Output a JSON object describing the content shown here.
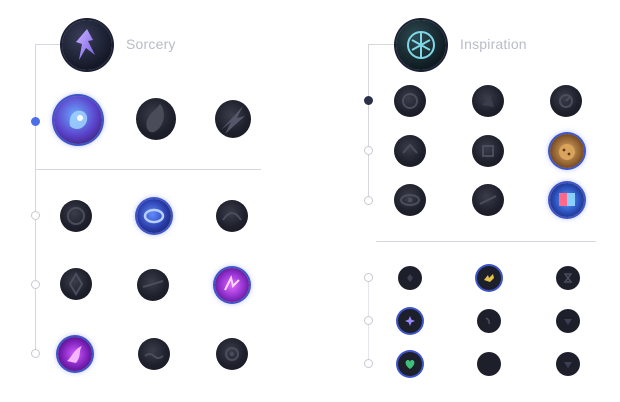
{
  "primary": {
    "title": "Sorcery",
    "icon": "sorcery-path-icon",
    "keystones": [
      {
        "icon": "summon-aery-icon",
        "selected": true
      },
      {
        "icon": "arcane-comet-icon",
        "selected": false
      },
      {
        "icon": "phase-rush-icon",
        "selected": false
      }
    ],
    "rows": [
      [
        {
          "icon": "nullifying-orb-icon",
          "selected": false
        },
        {
          "icon": "manaflow-band-icon",
          "selected": true
        },
        {
          "icon": "nimbus-cloak-icon",
          "selected": false
        }
      ],
      [
        {
          "icon": "transcendence-icon",
          "selected": false
        },
        {
          "icon": "celerity-icon",
          "selected": false
        },
        {
          "icon": "absolute-focus-icon",
          "selected": true
        }
      ],
      [
        {
          "icon": "scorch-icon",
          "selected": true
        },
        {
          "icon": "waterwalking-icon",
          "selected": false
        },
        {
          "icon": "gathering-storm-icon",
          "selected": false
        }
      ]
    ]
  },
  "secondary": {
    "title": "Inspiration",
    "icon": "inspiration-path-icon",
    "rows": [
      [
        {
          "icon": "hextech-flashtraption-icon",
          "selected": false
        },
        {
          "icon": "magical-footwear-icon",
          "selected": false
        },
        {
          "icon": "perfect-timing-icon",
          "selected": false
        }
      ],
      [
        {
          "icon": "future-market-icon",
          "selected": false
        },
        {
          "icon": "minion-dematerializer-icon",
          "selected": false
        },
        {
          "icon": "biscuit-delivery-icon",
          "selected": true
        }
      ],
      [
        {
          "icon": "cosmic-insight-icon",
          "selected": false
        },
        {
          "icon": "approach-velocity-icon",
          "selected": false
        },
        {
          "icon": "time-warp-tonic-icon",
          "selected": true
        }
      ]
    ],
    "shards": [
      [
        {
          "icon": "adaptive-force-shard-icon",
          "selected": false
        },
        {
          "icon": "attack-speed-shard-icon",
          "selected": true
        },
        {
          "icon": "ability-haste-shard-icon",
          "selected": false
        }
      ],
      [
        {
          "icon": "adaptive-force-shard-icon",
          "selected": true
        },
        {
          "icon": "armor-shard-icon",
          "selected": false
        },
        {
          "icon": "magic-resist-shard-icon",
          "selected": false
        }
      ],
      [
        {
          "icon": "health-shard-icon",
          "selected": true
        },
        {
          "icon": "armor-shard-icon",
          "selected": false
        },
        {
          "icon": "magic-resist-shard-icon",
          "selected": false
        }
      ]
    ]
  },
  "colors": {
    "accent": "#4a6fe8",
    "selected_ring": "#3d55c9",
    "line": "#d6d6de",
    "title": "#b9bcc8"
  }
}
